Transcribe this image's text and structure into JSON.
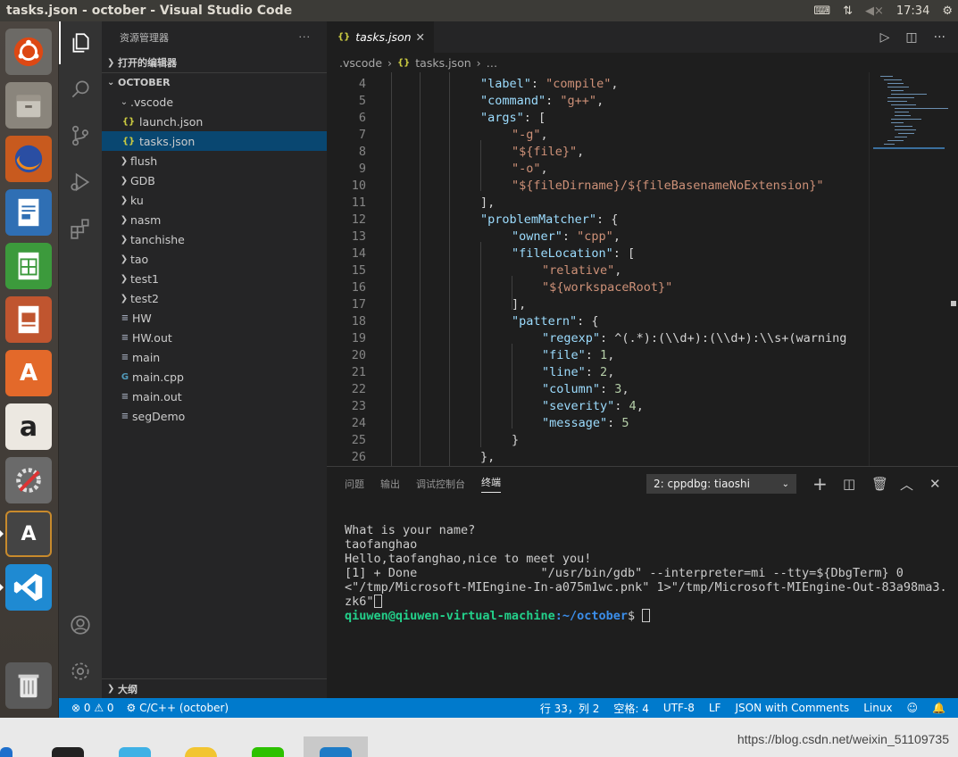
{
  "window": {
    "title": "tasks.json - october - Visual Studio Code",
    "clock": "17:34"
  },
  "sidebar": {
    "header": "资源管理器",
    "more": "···",
    "open_editors": "打开的编辑器",
    "root": "OCTOBER",
    "items": [
      {
        "label": ".vscode",
        "type": "folder-open"
      },
      {
        "label": "launch.json",
        "type": "json"
      },
      {
        "label": "tasks.json",
        "type": "json"
      },
      {
        "label": "flush",
        "type": "folder"
      },
      {
        "label": "GDB",
        "type": "folder"
      },
      {
        "label": "ku",
        "type": "folder"
      },
      {
        "label": "nasm",
        "type": "folder"
      },
      {
        "label": "tanchishe",
        "type": "folder"
      },
      {
        "label": "tao",
        "type": "folder"
      },
      {
        "label": "test1",
        "type": "folder"
      },
      {
        "label": "test2",
        "type": "folder"
      },
      {
        "label": "HW",
        "type": "file"
      },
      {
        "label": "HW.out",
        "type": "file"
      },
      {
        "label": "main",
        "type": "file"
      },
      {
        "label": "main.cpp",
        "type": "cpp"
      },
      {
        "label": "main.out",
        "type": "file"
      },
      {
        "label": "segDemo",
        "type": "file"
      }
    ],
    "outline": "大纲"
  },
  "editor": {
    "tab": "tasks.json",
    "breadcrumb": [
      ".vscode",
      "tasks.json",
      "…"
    ],
    "lines": [
      {
        "n": "4",
        "t": "\"label\": \"compile\","
      },
      {
        "n": "5",
        "t": "\"command\": \"g++\","
      },
      {
        "n": "6",
        "t": "\"args\": ["
      },
      {
        "n": "7",
        "t": "\"-g\","
      },
      {
        "n": "8",
        "t": "\"${file}\","
      },
      {
        "n": "9",
        "t": "\"-o\","
      },
      {
        "n": "10",
        "t": "\"${fileDirname}/${fileBasenameNoExtension}\""
      },
      {
        "n": "11",
        "t": "],"
      },
      {
        "n": "12",
        "t": "\"problemMatcher\": {"
      },
      {
        "n": "13",
        "t": "\"owner\": \"cpp\","
      },
      {
        "n": "14",
        "t": "\"fileLocation\": ["
      },
      {
        "n": "15",
        "t": "\"relative\","
      },
      {
        "n": "16",
        "t": "\"${workspaceRoot}\""
      },
      {
        "n": "17",
        "t": "],"
      },
      {
        "n": "18",
        "t": "\"pattern\": {"
      },
      {
        "n": "19",
        "t": "\"regexp\": \"^(.*):(\\\\d+):(\\\\d+):\\\\s+(warning"
      },
      {
        "n": "20",
        "t": "\"file\": 1,"
      },
      {
        "n": "21",
        "t": "\"line\": 2,"
      },
      {
        "n": "22",
        "t": "\"column\": 3,"
      },
      {
        "n": "23",
        "t": "\"severity\": 4,"
      },
      {
        "n": "24",
        "t": "\"message\": 5"
      },
      {
        "n": "25",
        "t": "}"
      },
      {
        "n": "26",
        "t": "},"
      }
    ]
  },
  "panel": {
    "tabs": [
      "问题",
      "输出",
      "调试控制台",
      "终端"
    ],
    "active_tab": "终端",
    "terminal_select": "2: cppdbg: tiaoshi",
    "terminal": {
      "line1": "What is your name?",
      "line2": "taofanghao",
      "line3": "Hello,taofanghao,nice to meet you!",
      "line4": "[1] + Done                 \"/usr/bin/gdb\" --interpreter=mi --tty=${DbgTerm} 0",
      "line5": "<\"/tmp/Microsoft-MIEngine-In-a075m1wc.pnk\" 1>\"/tmp/Microsoft-MIEngine-Out-83a98ma3.",
      "line6": "zk6\"",
      "prompt_user": "qiuwen@qiuwen-virtual-machine",
      "prompt_path": ":~/october",
      "prompt_end": "$ "
    }
  },
  "status": {
    "problems": "⊗ 0 ⚠ 0",
    "config": "C/C++ (october)",
    "position": "行 33，列 2",
    "spaces": "空格: 4",
    "encoding": "UTF-8",
    "eol": "LF",
    "language": "JSON with Comments",
    "platform": "Linux"
  },
  "watermark": "https://blog.csdn.net/weixin_51109735"
}
